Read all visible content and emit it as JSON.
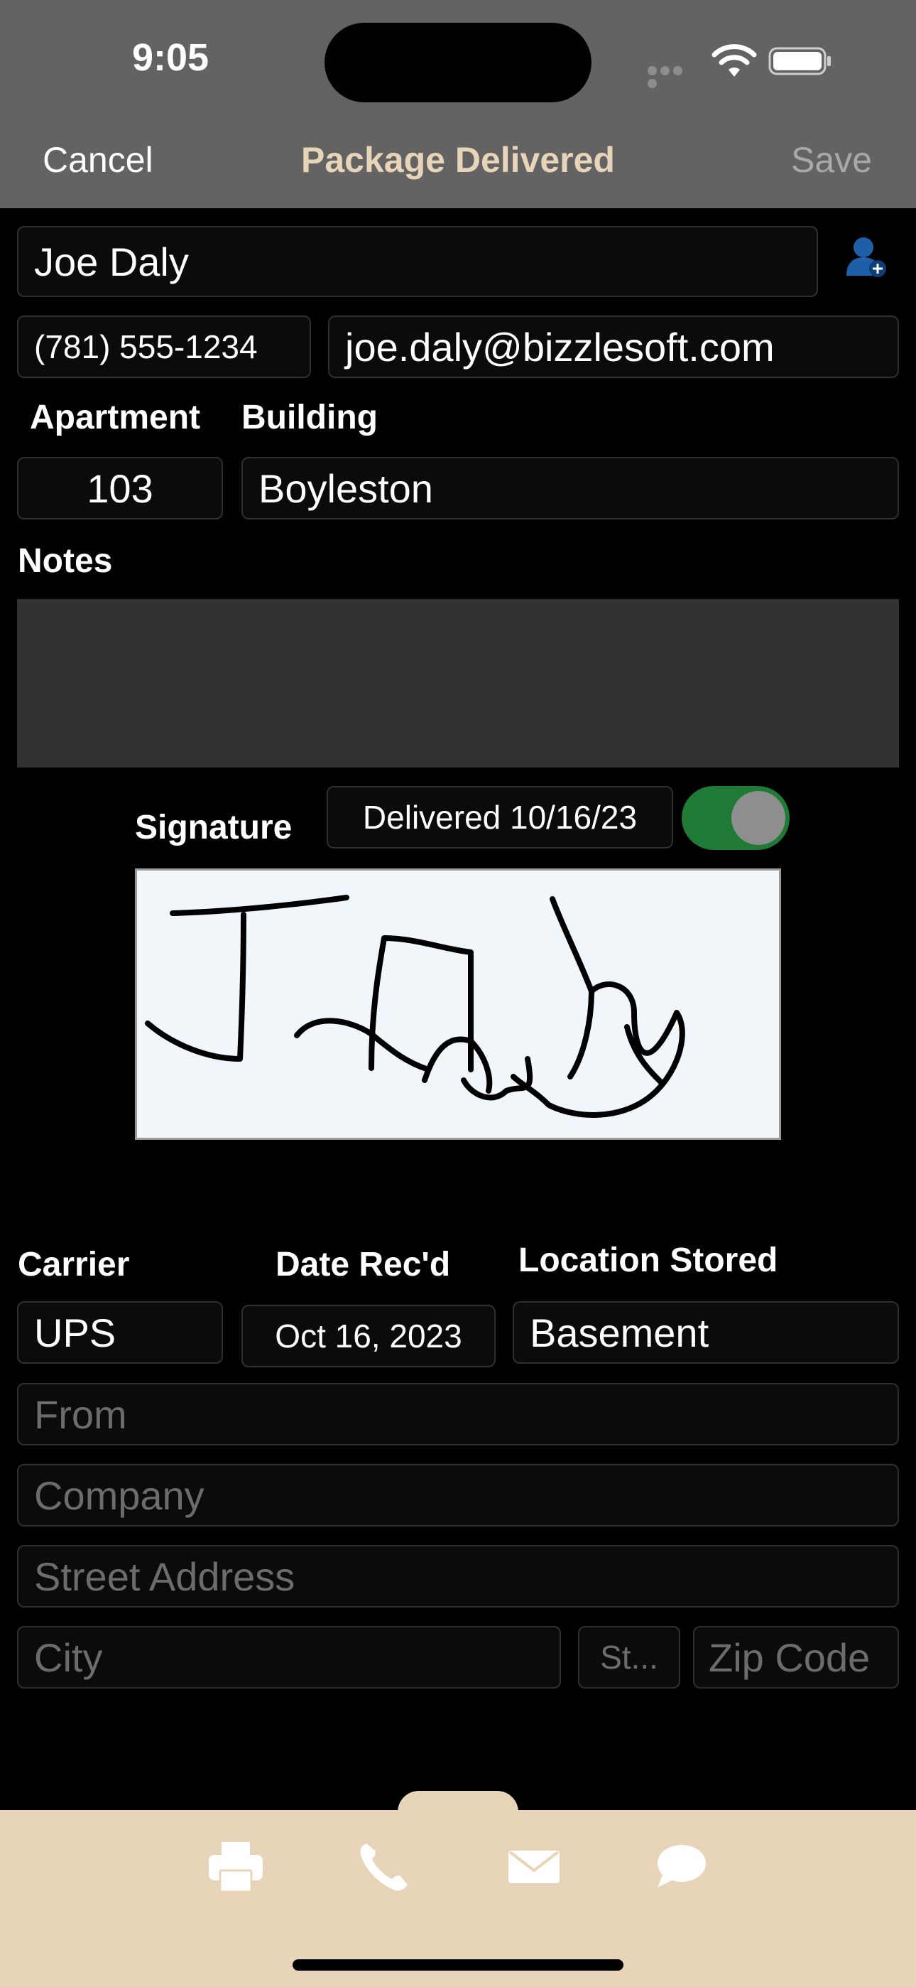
{
  "status_bar": {
    "time": "9:05"
  },
  "nav": {
    "cancel": "Cancel",
    "title": "Package Delivered",
    "save": "Save"
  },
  "recipient": {
    "name": "Joe Daly",
    "phone": "(781) 555-1234",
    "email": "joe.daly@bizzlesoft.com",
    "apartment_label": "Apartment",
    "building_label": "Building",
    "apartment": "103",
    "building": "Boyleston"
  },
  "notes": {
    "label": "Notes",
    "value": ""
  },
  "signature": {
    "label": "Signature",
    "delivered": "Delivered 10/16/23",
    "delivered_toggle_on": true
  },
  "package": {
    "carrier_label": "Carrier",
    "date_label": "Date Rec'd",
    "location_label": "Location Stored",
    "carrier": "UPS",
    "date": "Oct 16, 2023",
    "location": "Basement"
  },
  "sender": {
    "from_placeholder": "From",
    "company_placeholder": "Company",
    "street_placeholder": "Street Address",
    "city_placeholder": "City",
    "state_placeholder": "St...",
    "zip_placeholder": "Zip Code"
  },
  "tab_bar": {
    "icons": [
      "printer-icon",
      "phone-icon",
      "mail-icon",
      "message-icon"
    ]
  },
  "colors": {
    "header_bg": "#636363",
    "title": "#e8d4b8",
    "toggle_on": "#1f7a36",
    "tab_bar_bg": "#e8d4b8",
    "add_contact_icon": "#1d5fa8"
  }
}
